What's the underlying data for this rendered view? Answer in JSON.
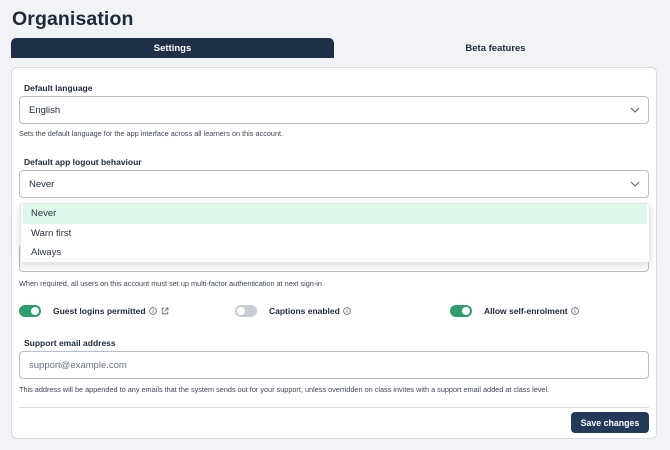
{
  "page": {
    "title": "Organisation"
  },
  "tabs": [
    {
      "label": "Settings",
      "active": true
    },
    {
      "label": "Beta features",
      "active": false
    }
  ],
  "default_language": {
    "label": "Default language",
    "value": "English",
    "help": "Sets the default language for the app interface across all learners on this account."
  },
  "logout": {
    "label": "Default app logout behaviour",
    "value": "Never",
    "options": [
      "Never",
      "Warn first",
      "Always"
    ],
    "selected_index": 0
  },
  "mfa": {
    "help": "When required, all users on this account must set up multi-factor authentication at next sign-in"
  },
  "toggles": [
    {
      "label": "Guest logins permitted",
      "on": true,
      "icons": [
        "info-icon",
        "external-link-icon"
      ]
    },
    {
      "label": "Captions enabled",
      "on": false,
      "icons": [
        "info-icon"
      ]
    },
    {
      "label": "Allow self-enrolment",
      "on": true,
      "icons": [
        "info-icon"
      ]
    }
  ],
  "support_email": {
    "label": "Support email address",
    "value": "",
    "placeholder": "support@example.com",
    "help": "This address will be appended to any emails that the system sends out for your support, unless overridden on class invites with a support email added at class level."
  },
  "actions": {
    "save_label": "Save changes"
  },
  "colors": {
    "primary": "#1f2f47",
    "toggle_on": "#2f9d6c",
    "toggle_off": "#c7cdd5",
    "selected_option": "#ddf7e8",
    "button": "#22395a"
  }
}
